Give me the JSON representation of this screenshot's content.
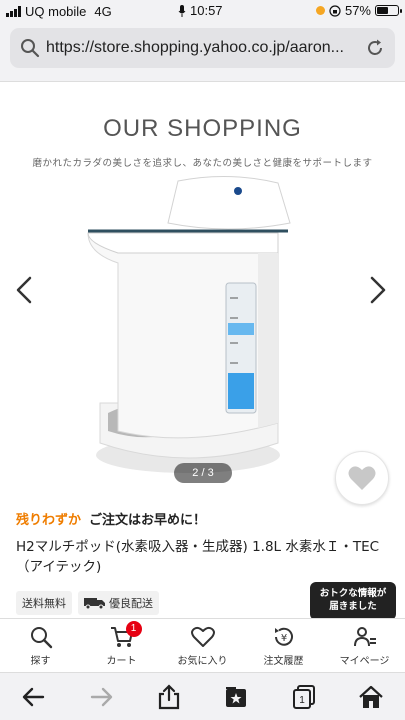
{
  "status_bar": {
    "carrier": "UQ mobile",
    "network": "4G",
    "time": "10:57",
    "battery_percent_label": "57%",
    "battery_level": 0.57
  },
  "url_bar": {
    "url": "https://store.shopping.yahoo.co.jp/aaron..."
  },
  "carousel": {
    "brand_title": "OUR SHOPPING",
    "tagline": "磨かれたカラダの美しさを追求し、あなたの美しさと健康をサポートします",
    "page_indicator": "2 / 3"
  },
  "product": {
    "stock_warning": "残りわずか",
    "stock_note": "ご注文はお早めに！",
    "name": "H2マルチポッド(水素吸入器・生成器) 1.8L 水素水Ｉ・TEC（アイテック)",
    "tags": [
      {
        "label": "送料無料"
      },
      {
        "label": "優良配送"
      }
    ],
    "promo_line1": "おトクな情報が",
    "promo_line2": "届きました"
  },
  "site_tabs": [
    {
      "label": "探す",
      "icon": "search-icon"
    },
    {
      "label": "カート",
      "icon": "cart-icon",
      "badge": "1"
    },
    {
      "label": "お気に入り",
      "icon": "heart-icon"
    },
    {
      "label": "注文履歴",
      "icon": "order-history-icon"
    },
    {
      "label": "マイページ",
      "icon": "user-icon"
    }
  ],
  "colors": {
    "accent_orange": "#ef7d00",
    "badge_red": "#e60012",
    "chrome_bg": "#f2f2f4"
  }
}
